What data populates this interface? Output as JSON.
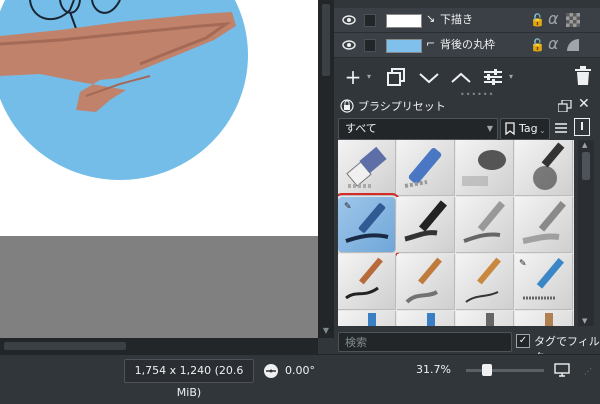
{
  "layers": [
    {
      "name": "下描き"
    },
    {
      "name": "背後の丸枠"
    }
  ],
  "layer_toolbar": {
    "add_icon": "plus-icon",
    "duplicate_icon": "duplicate-icon",
    "down_icon": "chevron-down-icon",
    "up_icon": "chevron-up-icon",
    "properties_icon": "sliders-icon",
    "delete_icon": "trash-icon"
  },
  "brush_presets": {
    "title": "ブラシプリセット",
    "filter_value": "すべて",
    "tag_label": "Tag",
    "search_placeholder": "検索",
    "filter_by_tag_label": "タグでフィルタ"
  },
  "status_bar": {
    "dimensions": "1,754 x 1,240 (20.6 MiB)",
    "rotation": "0.00°",
    "zoom": "31.7%"
  },
  "colors": {
    "accent": "#3daee9",
    "selection_outline": "#d42a2a",
    "panel_bg": "#31363b"
  }
}
